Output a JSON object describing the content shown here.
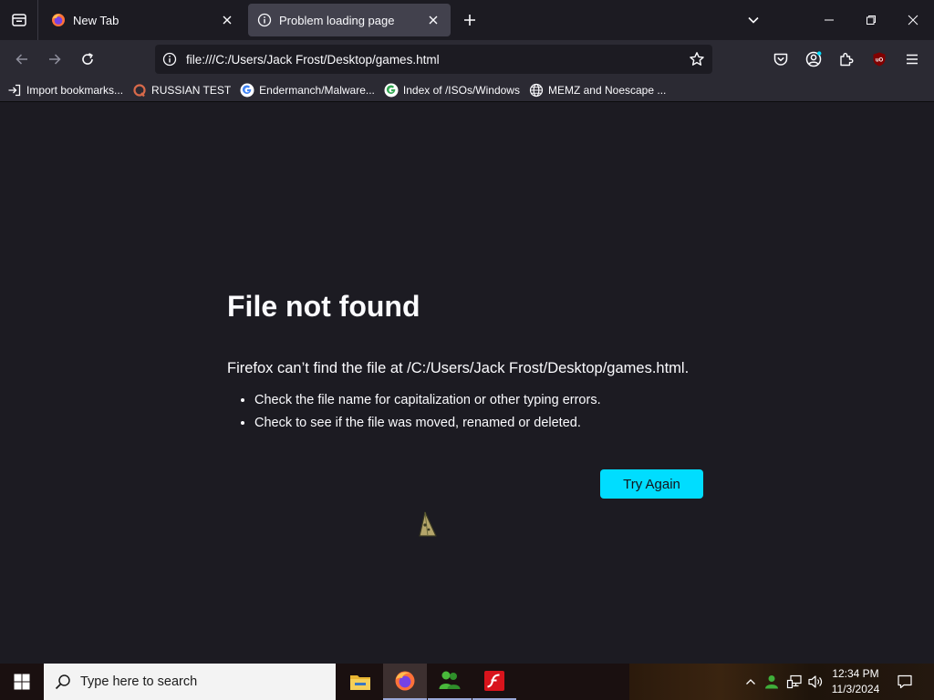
{
  "tabs": [
    {
      "title": "New Tab",
      "icon": "firefox-icon",
      "active": false
    },
    {
      "title": "Problem loading page",
      "icon": "info-icon",
      "active": true
    }
  ],
  "nav": {
    "url": "file:///C:/Users/Jack Frost/Desktop/games.html"
  },
  "bookmarks": [
    {
      "label": "Import bookmarks...",
      "icon": "import-icon"
    },
    {
      "label": "RUSSIAN TEST",
      "icon": "site-icon"
    },
    {
      "label": "Endermanch/Malware...",
      "icon": "google-icon"
    },
    {
      "label": "Index of /ISOs/Windows",
      "icon": "google-icon"
    },
    {
      "label": "MEMZ and Noescape ...",
      "icon": "globe-icon"
    }
  ],
  "error": {
    "title": "File not found",
    "description": "Firefox can’t find the file at /C:/Users/Jack Frost/Desktop/games.html.",
    "tips": [
      "Check the file name for capitalization or other typing errors.",
      "Check to see if the file was moved, renamed or deleted."
    ],
    "try_again": "Try Again"
  },
  "taskbar": {
    "search_placeholder": "Type here to search",
    "apps": [
      "file-explorer-icon",
      "firefox-icon",
      "messenger-icon",
      "flash-icon"
    ],
    "time": "12:34 PM",
    "date": "11/3/2024"
  },
  "colors": {
    "accent": "#00ddff",
    "page_bg": "#1c1b22",
    "toolbar_bg": "#2b2a33"
  }
}
